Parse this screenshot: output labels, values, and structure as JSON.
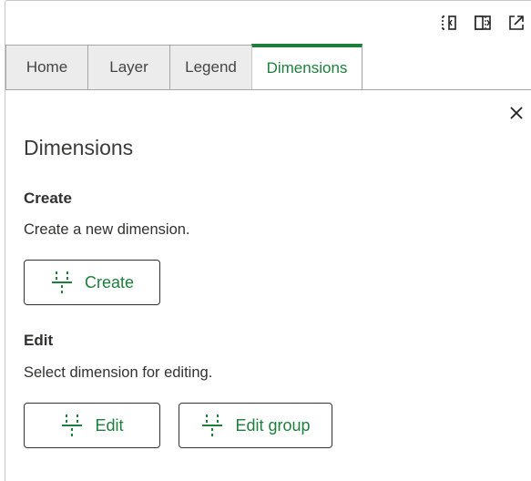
{
  "toolbar": {
    "icons": [
      "panel-collapse-icon",
      "panel-dock-icon",
      "popout-icon"
    ]
  },
  "tabs": [
    {
      "label": "Home"
    },
    {
      "label": "Layer"
    },
    {
      "label": "Legend"
    },
    {
      "label": "Dimensions",
      "active": true
    }
  ],
  "panel": {
    "title": "Dimensions",
    "create": {
      "heading": "Create",
      "description": "Create a new dimension.",
      "button_label": "Create"
    },
    "edit": {
      "heading": "Edit",
      "description": "Select dimension for editing.",
      "edit_button_label": "Edit",
      "edit_group_button_label": "Edit group"
    }
  },
  "colors": {
    "accent": "#1e7f3c",
    "tab_inactive_bg": "#ececec",
    "text": "#323130"
  }
}
